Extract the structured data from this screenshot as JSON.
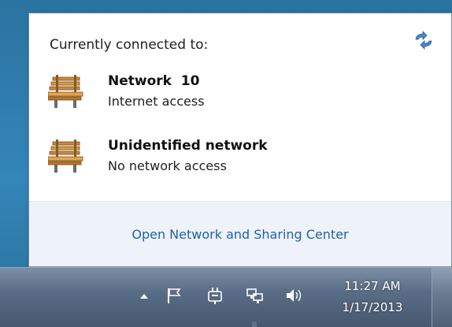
{
  "flyout": {
    "title": "Currently connected to:",
    "refresh_icon": "refresh-arrows-icon",
    "networks": [
      {
        "name": "Network  10",
        "status": "Internet access",
        "icon": "network-bench-icon"
      },
      {
        "name": "Unidentified network",
        "status": "No network access",
        "icon": "network-bench-icon"
      }
    ],
    "footer_link": "Open Network and Sharing Center"
  },
  "taskbar": {
    "tray_icons": [
      "show-hidden-icons-arrow-icon",
      "action-center-flag-icon",
      "power-plug-icon",
      "network-icon",
      "volume-icon"
    ],
    "clock": {
      "time": "11:27 AM",
      "date": "1/17/2013"
    }
  },
  "colors": {
    "desktop": "#2f79a7",
    "link": "#1f5fae",
    "footer_bg": "#eef3fa",
    "taskbar": "#5a6d86"
  }
}
